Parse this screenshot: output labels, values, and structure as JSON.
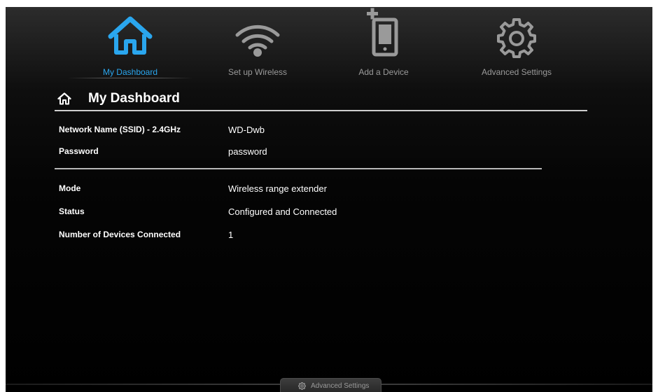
{
  "nav": {
    "items": [
      {
        "label": "My Dashboard",
        "icon": "home-icon",
        "active": true
      },
      {
        "label": "Set up Wireless",
        "icon": "wifi-icon",
        "active": false
      },
      {
        "label": "Add a Device",
        "icon": "add-device-icon",
        "active": false
      },
      {
        "label": "Advanced Settings",
        "icon": "gear-icon",
        "active": false
      }
    ]
  },
  "page": {
    "title": "My Dashboard",
    "title_icon": "home-icon"
  },
  "network": {
    "ssid_label": "Network Name (SSID) - 2.4GHz",
    "ssid_value": "WD-Dwb",
    "password_label": "Password",
    "password_value": "password"
  },
  "status": {
    "mode_label": "Mode",
    "mode_value": "Wireless range extender",
    "status_label": "Status",
    "status_value": "Configured and Connected",
    "devices_label": "Number of Devices Connected",
    "devices_value": "1"
  },
  "footer": {
    "tab_label": "Advanced Settings",
    "tab_icon": "gear-icon"
  },
  "colors": {
    "accent": "#2aa6ee",
    "inactive_icon": "#9a9a9a",
    "text": "#ffffff",
    "background": "#000000"
  }
}
